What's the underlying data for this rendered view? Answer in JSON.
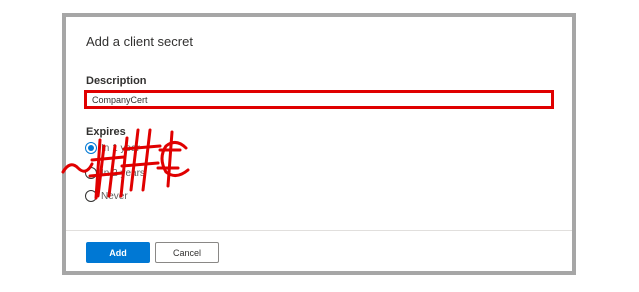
{
  "dialog": {
    "title": "Add a client secret",
    "description_label": "Description",
    "description_value": "CompanyCert",
    "expires_label": "Expires",
    "expires_options": [
      {
        "label": "In 1 year",
        "checked": true
      },
      {
        "label": "In 2 years",
        "checked": false
      },
      {
        "label": "Never",
        "checked": false
      }
    ],
    "add_label": "Add",
    "cancel_label": "Cancel"
  },
  "colors": {
    "highlight": "#e00000",
    "primary": "#0078d4",
    "frame_border": "#a6a6a6"
  }
}
